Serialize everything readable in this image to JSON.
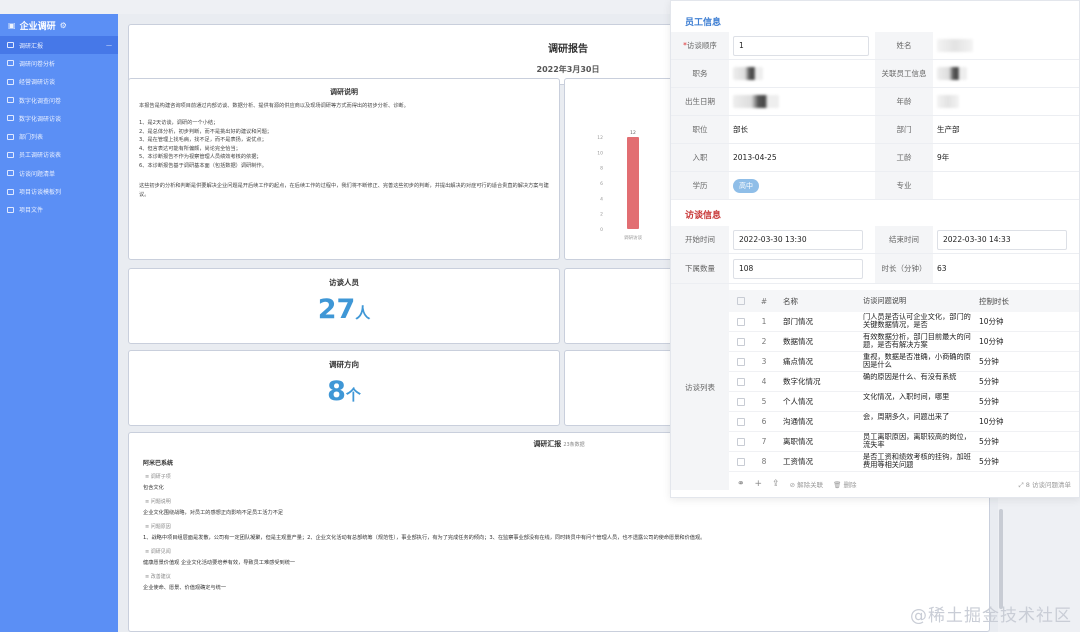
{
  "sidebar": {
    "title": "企业调研",
    "items": [
      {
        "label": "调研汇报"
      },
      {
        "label": "调研问卷分析"
      },
      {
        "label": "经营调研访谈"
      },
      {
        "label": "数字化调查问卷"
      },
      {
        "label": "数字化调研访谈"
      },
      {
        "label": "部门列表"
      },
      {
        "label": "员工调研访谈表"
      },
      {
        "label": "访谈问题清单"
      },
      {
        "label": "项目访谈模板列"
      },
      {
        "label": "项目文件"
      }
    ]
  },
  "report": {
    "title": "调研报告",
    "date": "2022年3月30日",
    "desc_heading": "调研说明",
    "desc_intro": "本报告是构建咨询项目前通过内部访谈、数据分析、提供有源的供应商以及现场调研等方式而得出的初步分析、诊断。",
    "desc_list": [
      "1、是2天访谈，调研的一个小结；",
      "2、是总体分析，初步判断，而不是挑出好的建议和问题；",
      "3、是在管理上找毛病，找不足，而不是表扬，说优点；",
      "4、但言表达可能有所偏颇，尚论完全恰当；",
      "5、本诊断报告不作为视察管理人员绩效考核的依据；",
      "6、本诊断报告基于调研基本面（包括数据）调研制作。"
    ],
    "desc_outro": "这些初步的分析和判断是供要解决企业问题是开后续工作的起点，在后续工作的过程中，我们将不断修正、完善这些初步的判断，并提出解决的对症可行的适合贵直的解决方案与建议。",
    "interviewees_label": "访谈人员",
    "interviewees_num": "27",
    "interviewees_unit": "人",
    "directions_label": "调研方向",
    "directions_num": "8",
    "directions_unit": "个",
    "summary_heading": "调研汇报",
    "summary_sub": "23条数据",
    "company": "阿米巴系统",
    "sections": [
      {
        "label": "调研子项",
        "value": "包含文化"
      },
      {
        "label": "问题说明",
        "value": "企业文化围绕战略，对员工的感想正向影响不足员工活力不足"
      },
      {
        "label": "问题原因",
        "value": "1、战略中项目组层面是发散，公司有一定团队凝聚，但是主观重产量；2、企业文化活动有总部统筹（规范性），事业部执行，有为了完成任务的倾向；3、在监察事业部没有在线，同时转员中有问个管理人员，也不透露公司的使命愿景和价值观。"
      },
      {
        "label": "调研见闻",
        "value": "健康愿景价值观 企业文化活动要培养有效，导致员工难感受到统一"
      },
      {
        "label": "改善建议",
        "value": "企业使命、愿景、价值观确定与统一"
      }
    ]
  },
  "chart_data": {
    "type": "bar",
    "categories": [
      "调研访谈"
    ],
    "values": [
      12
    ],
    "title": "",
    "xlabel": "",
    "ylabel": "",
    "ylim": [
      0,
      12
    ],
    "yticks": [
      "0",
      "2",
      "4",
      "6",
      "8",
      "10",
      "12"
    ],
    "data_labels": [
      "12"
    ],
    "colors": {
      "bar": "#e26e72"
    }
  },
  "employee": {
    "section_title": "员工信息",
    "fields": {
      "order_label": "访谈顺序",
      "order_value": "1",
      "name_label": "姓名",
      "duty_label": "职务",
      "related_label": "关联员工信息",
      "birth_label": "出生日期",
      "age_label": "年龄",
      "position_label": "职位",
      "position_value": "部长",
      "dept_label": "部门",
      "dept_value": "生产部",
      "entry_label": "入职",
      "entry_value": "2013-04-25",
      "tenure_label": "工龄",
      "tenure_value": "9年",
      "edu_label": "学历",
      "edu_value": "高中",
      "major_label": "专业"
    }
  },
  "interview": {
    "section_title": "访谈信息",
    "start_label": "开始时间",
    "start_value": "2022-03-30 13:30",
    "end_label": "结束时间",
    "end_value": "2022-03-30 14:33",
    "subordinates_label": "下属数量",
    "subordinates_value": "108",
    "duration_label": "时长（分钟）",
    "duration_value": "63",
    "list_label": "访谈列表",
    "columns": [
      "#",
      "名称",
      "访谈问题说明",
      "控制时长"
    ],
    "rows": [
      {
        "no": "1",
        "name": "部门情况",
        "desc": "门人员是否认可企业文化，部门的关键数据情况，是否",
        "dur": "10分钟"
      },
      {
        "no": "2",
        "name": "数据情况",
        "desc": "有效数据分析，部门目前最大的问题，是否有解决方案",
        "dur": "10分钟"
      },
      {
        "no": "3",
        "name": "痛点情况",
        "desc": "重视，数据是否准确，小商确的原因是什么",
        "dur": "5分钟"
      },
      {
        "no": "4",
        "name": "数字化情况",
        "desc": "确的原因是什么、有没有系统",
        "dur": "5分钟"
      },
      {
        "no": "5",
        "name": "个人情况",
        "desc": "文化情况，入职时间，哪里",
        "dur": "5分钟"
      },
      {
        "no": "6",
        "name": "沟通情况",
        "desc": "会，周期多久，问题出来了",
        "dur": "10分钟"
      },
      {
        "no": "7",
        "name": "离职情况",
        "desc": "员工离职原因，离职较高的岗位，流失率",
        "dur": "5分钟"
      },
      {
        "no": "8",
        "name": "工资情况",
        "desc": "是否工资和绩效考核的挂钩，加班费用等相关问题",
        "dur": "5分钟"
      }
    ],
    "footer_unlink": "解除关联",
    "footer_delete": "删除",
    "footer_count": "8 访谈问题清单"
  },
  "watermark": "@稀土掘金技术社区"
}
